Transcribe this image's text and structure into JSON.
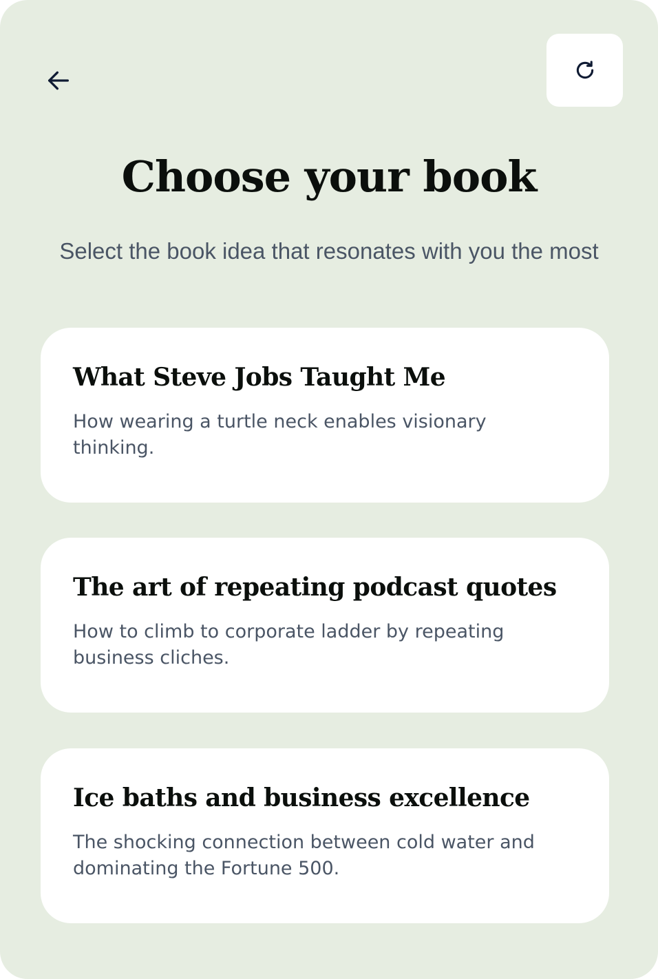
{
  "header": {
    "title": "Choose your book",
    "subtitle": "Select the book idea that resonates with you the most"
  },
  "icons": {
    "back": "arrow-left-icon",
    "refresh": "refresh-icon"
  },
  "books": [
    {
      "title": "What Steve Jobs Taught Me",
      "description": "How wearing a turtle neck enables visionary thinking."
    },
    {
      "title": "The art of repeating podcast quotes",
      "description": "How to climb to corporate ladder by repeating business cliches."
    },
    {
      "title": "Ice baths and business excellence",
      "description": "The shocking connection between cold water and dominating the Fortune 500."
    }
  ],
  "colors": {
    "background": "#e6ede1",
    "card": "#ffffff",
    "heading": "#0b0f0c",
    "body_text": "#4a5565",
    "icon": "#0f1b33"
  }
}
